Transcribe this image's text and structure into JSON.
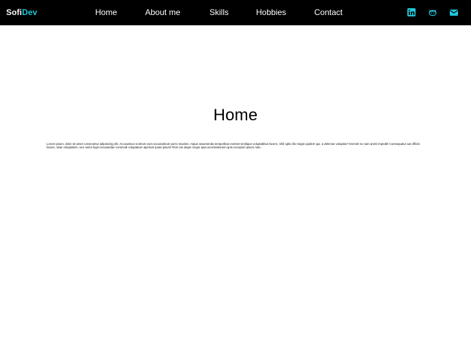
{
  "header": {
    "logo": {
      "part_1": "Sofi",
      "part_2": "Dev"
    },
    "nav": [
      {
        "label": "Home"
      },
      {
        "label": "About me"
      },
      {
        "label": "Skills"
      },
      {
        "label": "Hobbies"
      },
      {
        "label": "Contact"
      }
    ],
    "social_icons": [
      "linkedin-icon",
      "github-icon",
      "mail-icon"
    ]
  },
  "main": {
    "title": "Home",
    "paragraph": "Lorem ipsum, dolor sit amet consectetur adipisicing elit. Accusamus nostrum eum accusantium porro maxime. Atque assumenda temporibus eveniet similique voluptatibus facere, nihil optio illo magni quidem qui, a delectus voluptas? Eveniet ex nam animi impedit! Consequatur aut officiis facere, vitae voluptatem, iure animi fugit recusandae commodi voluptatum aperiam ipsas ipsum! Rem est atque neque ipsa exercitationem quis excepturi ipsum nam."
  },
  "colors": {
    "navbar_background": "#000000",
    "logo_accent": "#1fc7d8",
    "icon_accent": "#1fc7d8",
    "page_background": "#ffffff",
    "text": "#000000"
  }
}
